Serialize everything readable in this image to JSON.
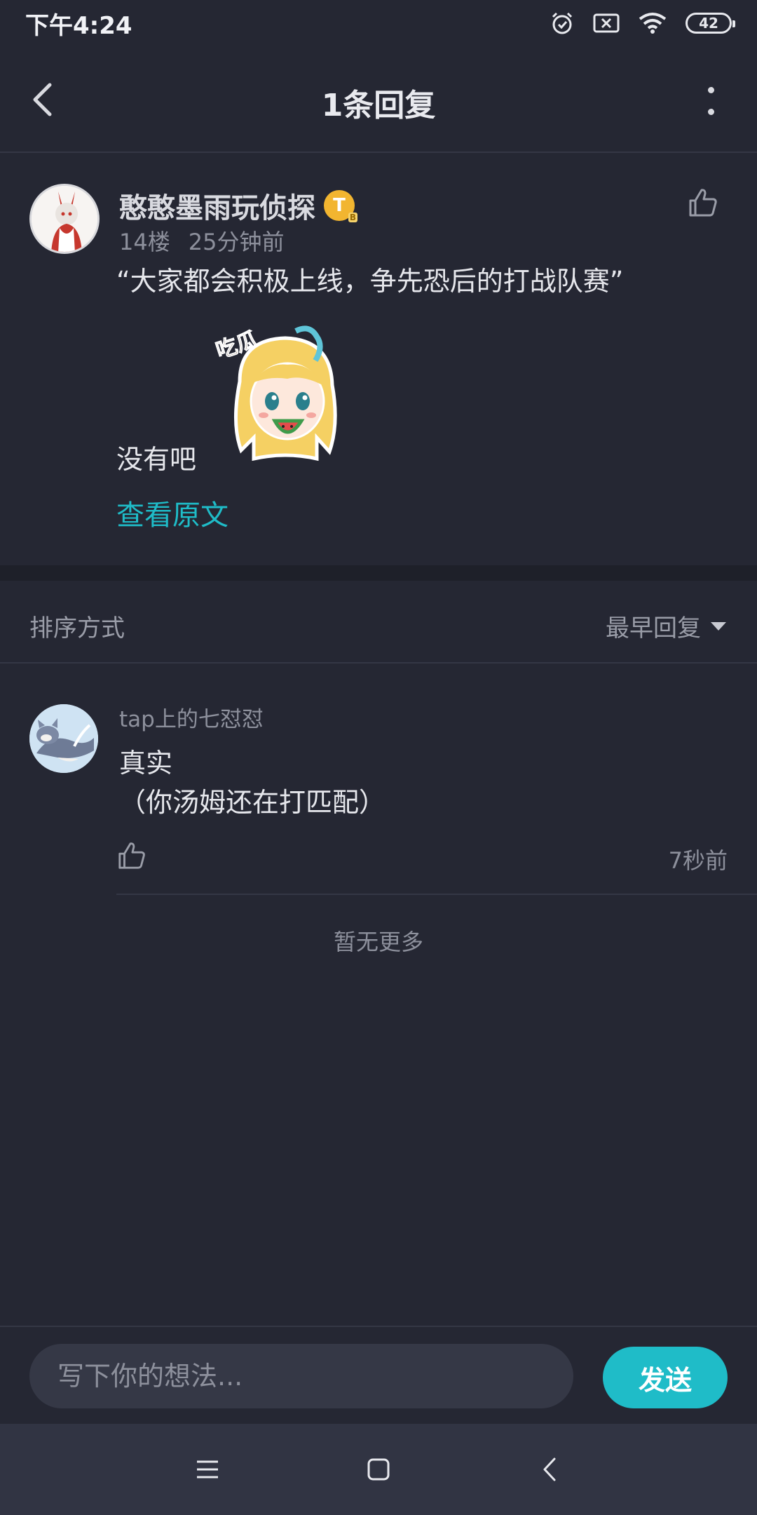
{
  "status_bar": {
    "time": "下午4:24",
    "battery": "42",
    "icons": [
      "alarm-icon",
      "sim-off-icon",
      "wifi-icon",
      "battery-icon"
    ]
  },
  "header": {
    "title": "1条回复",
    "back_icon": "back-arrow-icon",
    "more_icon": "more-vertical-icon"
  },
  "post": {
    "author": "憨憨墨雨玩侦探",
    "badge": "T",
    "floor": "14楼",
    "time": "25分钟前",
    "quote": "“大家都会积极上线，争先恐后的打战队赛”",
    "text": "没有吧",
    "sticker_caption": "吃瓜",
    "view_original": "查看原文"
  },
  "sort": {
    "label": "排序方式",
    "selected": "最早回复"
  },
  "replies": [
    {
      "author": "tap上的七怼怼",
      "line1": "真实",
      "line2": "（你汤姆还在打匹配）",
      "time": "7秒前"
    }
  ],
  "footer_note": "暂无更多",
  "input": {
    "placeholder": "写下你的想法...",
    "send_label": "发送"
  },
  "colors": {
    "background": "#252733",
    "accent": "#1fbcc8",
    "muted_text": "#8d909c"
  }
}
